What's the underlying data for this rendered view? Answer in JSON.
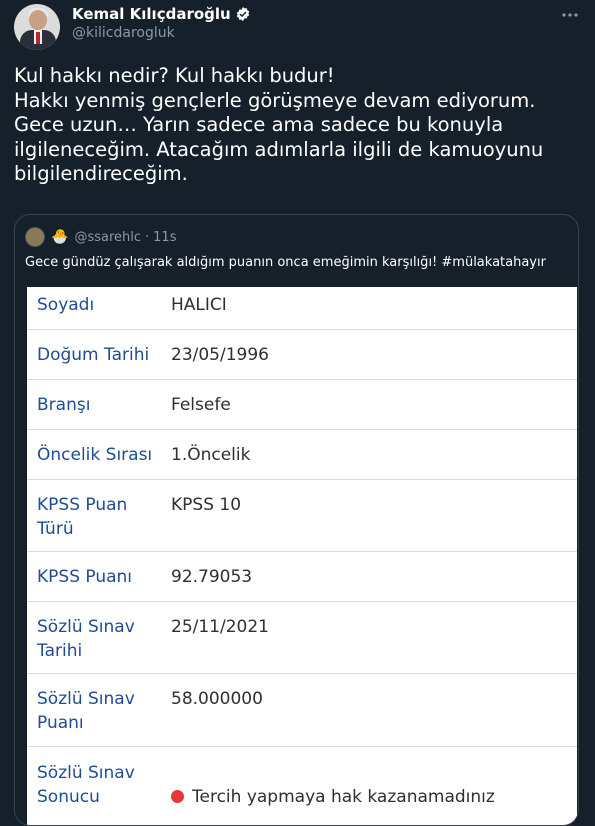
{
  "author": {
    "name": "Kemal Kılıçdaroğlu",
    "handle": "@kilicdarogluk"
  },
  "tweet": {
    "text": "Kul hakkı nedir? Kul hakkı budur!\nHakkı yenmiş gençlerle görüşmeye devam ediyorum.\nGece uzun… Yarın sadece ama sadece bu konuyla ilgileneceğim. Atacağım adımlarla ilgili de kamuoyunu bilgilendireceğim."
  },
  "quoted": {
    "emoji": "🐣",
    "handle": "@ssarehlc",
    "separator": "·",
    "time": "11s",
    "text": "Gece gündüz çalışarak aldığım puanın onca emeğimin karşılığı!  #mülakatahayır"
  },
  "record": [
    {
      "label": "Soyadı",
      "value": "HALICI"
    },
    {
      "label": "Doğum Tarihi",
      "value": "23/05/1996"
    },
    {
      "label": "Branşı",
      "value": "Felsefe"
    },
    {
      "label": "Öncelik Sırası",
      "value": "1.Öncelik"
    },
    {
      "label": "KPSS Puan\nTürü",
      "value": "KPSS 10"
    },
    {
      "label": "KPSS Puanı",
      "value": "92.79053"
    },
    {
      "label": "Sözlü Sınav\nTarihi",
      "value": "25/11/2021"
    },
    {
      "label": "Sözlü Sınav\nPuanı",
      "value": "58.000000"
    },
    {
      "label": "Sözlü Sınav\nSonucu",
      "value": "Tercih yapmaya hak kazanamadınız"
    }
  ],
  "colors": {
    "background": "#15202b",
    "label_blue": "#1f4d91",
    "status_red": "#e53935",
    "verified_blue": "#1d9bf0"
  },
  "icons": [
    "verified-badge-icon",
    "more-options-icon",
    "status-dot-icon"
  ]
}
